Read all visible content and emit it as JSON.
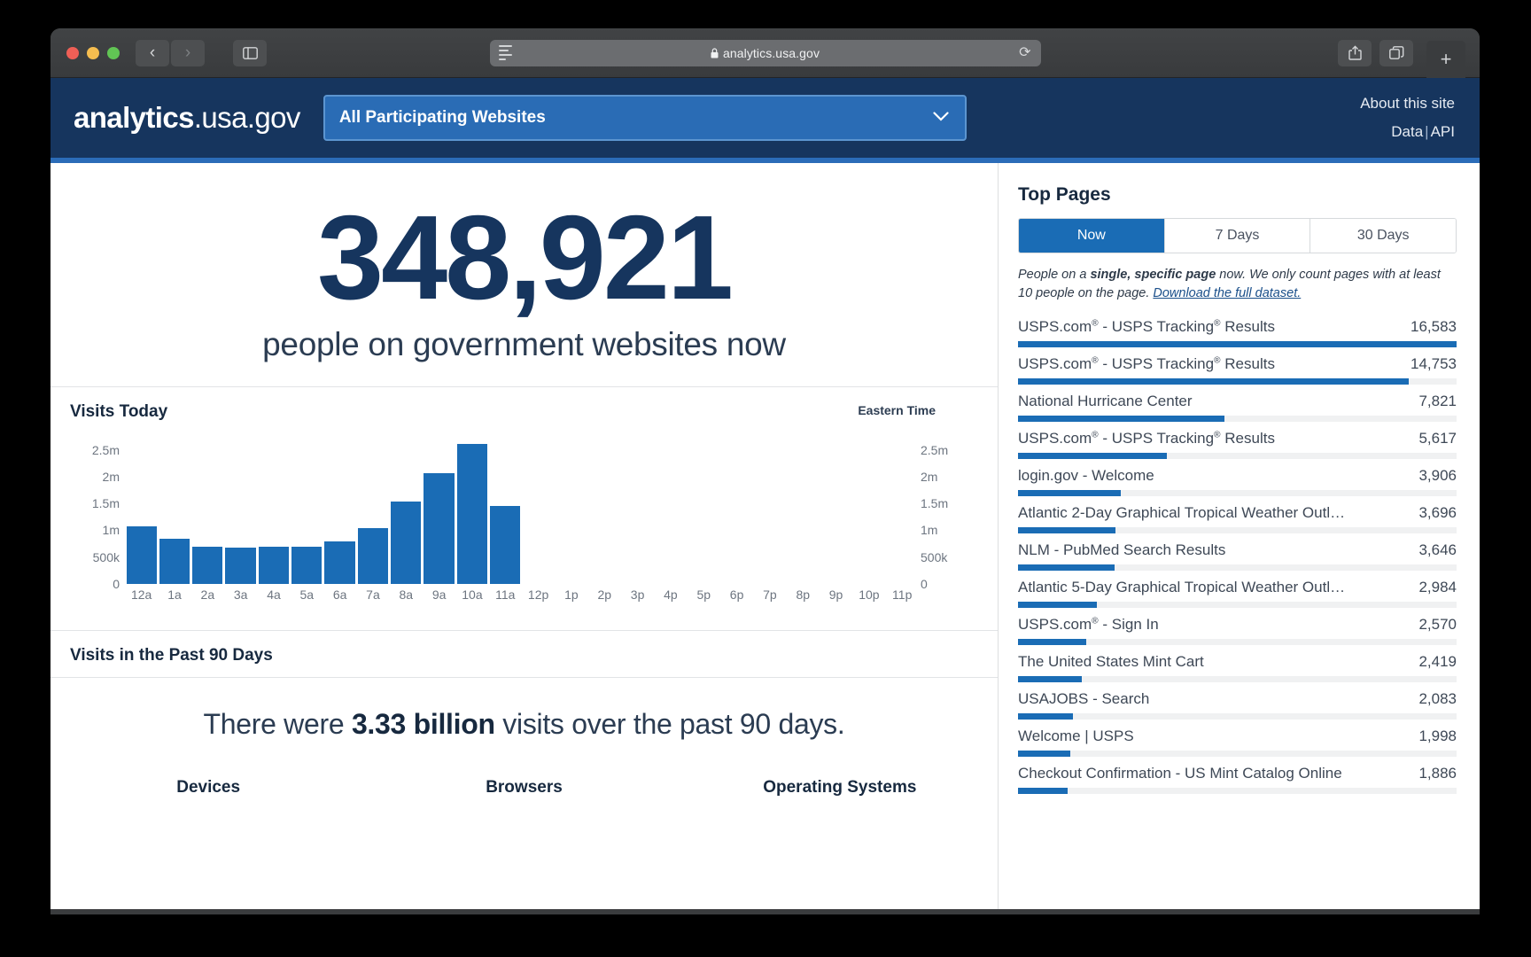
{
  "browser": {
    "url": "analytics.usa.gov",
    "lock_icon": "lock-icon",
    "reader_icon": "reader-view-icon",
    "reload_icon": "reload-icon",
    "back_icon": "back-chevron-icon",
    "forward_icon": "forward-chevron-icon",
    "sidebar_icon": "sidebar-toggle-icon",
    "share_icon": "share-icon",
    "tabs_icon": "tab-overview-icon",
    "new_tab_icon": "plus-icon",
    "reload_glyph": "⟳",
    "back_glyph": "‹",
    "forward_glyph": "›",
    "lock_glyph": "🔒",
    "plus_glyph": "+"
  },
  "header": {
    "logo_bold": "analytics",
    "logo_rest": ".usa.gov",
    "select_value": "All Participating Websites",
    "select_caret": "⌄",
    "about_link": "About this site",
    "data_link": "Data",
    "separator": "|",
    "api_link": "API"
  },
  "realtime": {
    "count": "348,921",
    "caption": "people on government websites now"
  },
  "visits_today": {
    "title": "Visits Today",
    "timezone_label": "Eastern Time"
  },
  "past90": {
    "title": "Visits in the Past 90 Days",
    "sentence_pre": "There were ",
    "sentence_bold": "3.33 billion",
    "sentence_post": " visits over the past 90 days.",
    "columns": [
      "Devices",
      "Browsers",
      "Operating Systems"
    ]
  },
  "top_pages": {
    "title": "Top Pages",
    "tabs": [
      {
        "label": "Now",
        "active": true
      },
      {
        "label": "7 Days",
        "active": false
      },
      {
        "label": "30 Days",
        "active": false
      }
    ],
    "note_pre": "People on a ",
    "note_bold": "single, specific page",
    "note_mid": " now. We only count pages with at least 10 people on the page. ",
    "note_link": "Download the full dataset.",
    "rows": [
      {
        "label_html": "USPS.com<sup>®</sup> - USPS Tracking<sup>®</sup> Results",
        "value": "16,583",
        "pct": 100
      },
      {
        "label_html": "USPS.com<sup>®</sup> - USPS Tracking<sup>®</sup> Results",
        "value": "14,753",
        "pct": 89
      },
      {
        "label_html": "National Hurricane Center",
        "value": "7,821",
        "pct": 47
      },
      {
        "label_html": "USPS.com<sup>®</sup> - USPS Tracking<sup>®</sup> Results",
        "value": "5,617",
        "pct": 34
      },
      {
        "label_html": "login.gov - Welcome",
        "value": "3,906",
        "pct": 23.5
      },
      {
        "label_html": "Atlantic 2-Day Graphical Tropical Weather Outl…",
        "value": "3,696",
        "pct": 22.3
      },
      {
        "label_html": "NLM - PubMed Search Results",
        "value": "3,646",
        "pct": 22
      },
      {
        "label_html": "Atlantic 5-Day Graphical Tropical Weather Outl…",
        "value": "2,984",
        "pct": 18
      },
      {
        "label_html": "USPS.com<sup>®</sup> - Sign In",
        "value": "2,570",
        "pct": 15.5
      },
      {
        "label_html": "The United States Mint Cart",
        "value": "2,419",
        "pct": 14.6
      },
      {
        "label_html": "USAJOBS - Search",
        "value": "2,083",
        "pct": 12.6
      },
      {
        "label_html": "Welcome | USPS",
        "value": "1,998",
        "pct": 12
      },
      {
        "label_html": "Checkout Confirmation - US Mint Catalog Online",
        "value": "1,886",
        "pct": 11.4
      }
    ]
  },
  "colors": {
    "navy": "#16355e",
    "blue": "#1a6cb5",
    "accent_rule": "#2b6cb8"
  },
  "chart_data": {
    "type": "bar",
    "title": "Visits Today",
    "xlabel": "",
    "ylabel": "",
    "timezone": "Eastern Time",
    "ylim": [
      0,
      2750000
    ],
    "ytick_labels": [
      "2.5m",
      "2m",
      "1.5m",
      "1m",
      "500k",
      "0"
    ],
    "ytick_values": [
      2500000,
      2000000,
      1500000,
      1000000,
      500000,
      0
    ],
    "grid": false,
    "axis_right_mirror": true,
    "categories": [
      "12a",
      "1a",
      "2a",
      "3a",
      "4a",
      "5a",
      "6a",
      "7a",
      "8a",
      "9a",
      "10a",
      "11a",
      "12p",
      "1p",
      "2p",
      "3p",
      "4p",
      "5p",
      "6p",
      "7p",
      "8p",
      "9p",
      "10p",
      "11p"
    ],
    "values": [
      1080000,
      840000,
      700000,
      680000,
      690000,
      700000,
      790000,
      1040000,
      1530000,
      2060000,
      2620000,
      1450000,
      null,
      null,
      null,
      null,
      null,
      null,
      null,
      null,
      null,
      null,
      null,
      null
    ]
  }
}
